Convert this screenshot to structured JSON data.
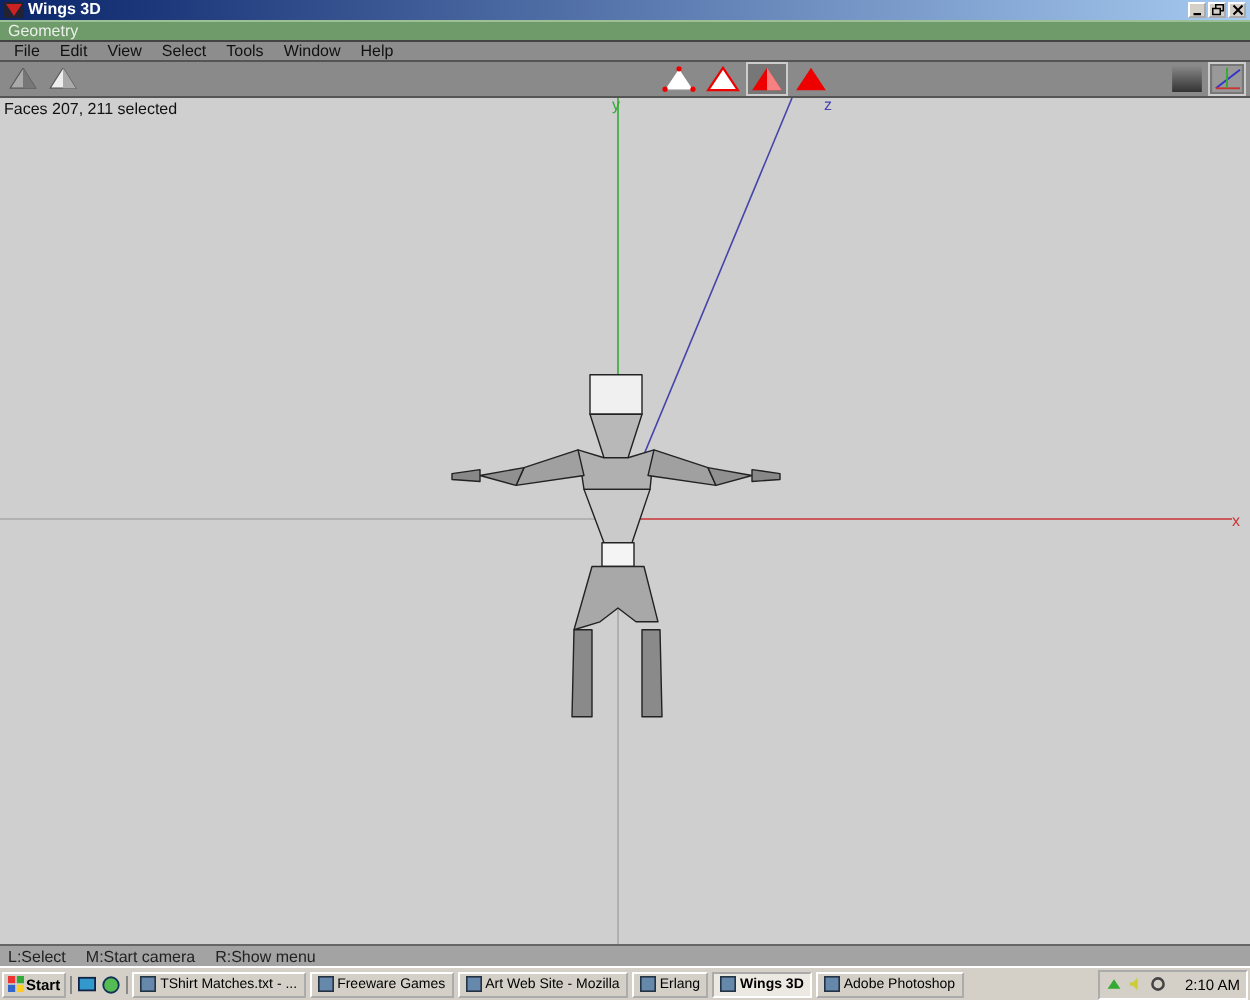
{
  "window": {
    "title": "Wings 3D"
  },
  "panel": {
    "title": "Geometry"
  },
  "menu": [
    "File",
    "Edit",
    "View",
    "Select",
    "Tools",
    "Window",
    "Help"
  ],
  "selection_modes": [
    {
      "kind": "vertex",
      "selected": false
    },
    {
      "kind": "edge",
      "selected": false
    },
    {
      "kind": "face",
      "selected": true
    },
    {
      "kind": "body",
      "selected": false
    }
  ],
  "status": "Faces 207, 211 selected",
  "axis_labels": {
    "y": "y",
    "z": "z",
    "x": "x"
  },
  "hints": [
    "L:Select",
    "M:Start camera",
    "R:Show menu"
  ],
  "taskbar": {
    "start": "Start",
    "tasks": [
      {
        "label": "TShirt Matches.txt - ...",
        "selected": false
      },
      {
        "label": "Freeware Games",
        "selected": false
      },
      {
        "label": "Art Web Site - Mozilla",
        "selected": false
      },
      {
        "label": "Erlang",
        "selected": false
      },
      {
        "label": "Wings 3D",
        "selected": true
      },
      {
        "label": "Adobe Photoshop",
        "selected": false
      }
    ],
    "clock": "2:10 AM"
  }
}
